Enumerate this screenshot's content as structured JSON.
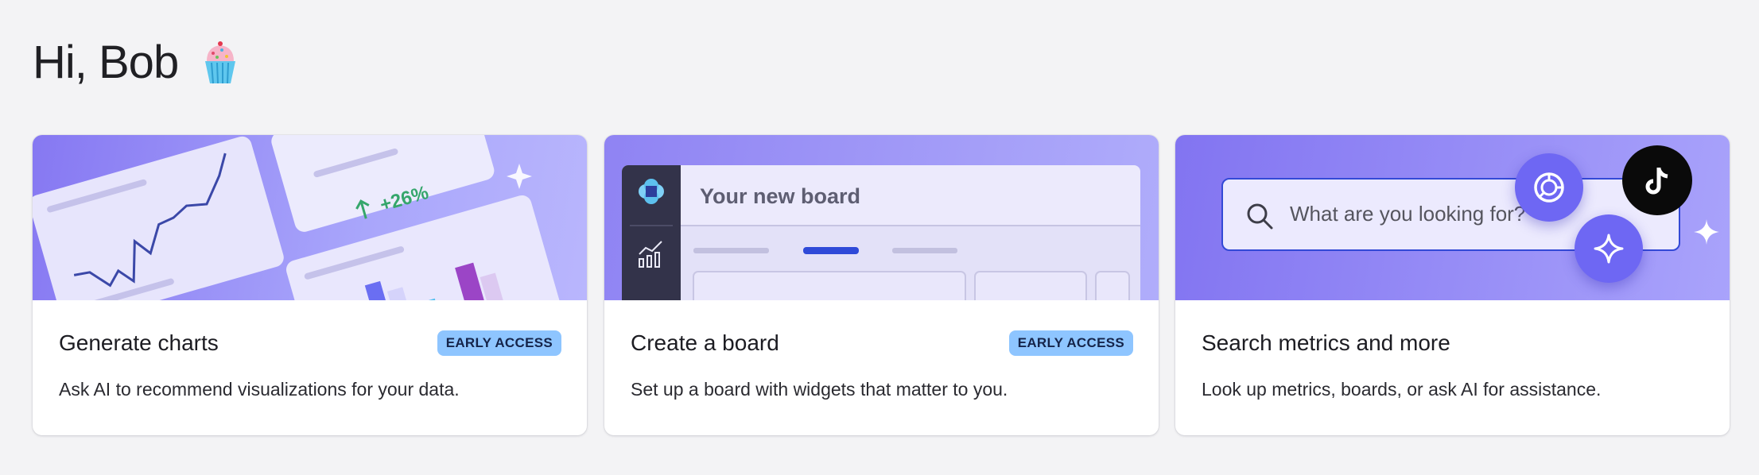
{
  "greeting": {
    "text": "Hi, Bob",
    "emoji": "cupcake-icon"
  },
  "cards": [
    {
      "title": "Generate charts",
      "badge": "EARLY ACCESS",
      "description": "Ask AI to recommend visualizations for your data.",
      "hero": {
        "growth_label": "+26%"
      }
    },
    {
      "title": "Create a board",
      "badge": "EARLY ACCESS",
      "description": "Set up a board with widgets that matter to you.",
      "hero": {
        "board_title": "Your new board"
      }
    },
    {
      "title": "Search metrics and more",
      "description": "Look up metrics, boards, or ask AI for assistance.",
      "hero": {
        "search_placeholder": "What are you looking for?"
      }
    }
  ],
  "colors": {
    "accent": "#8ec5ff",
    "hero": "#8678f2",
    "search_border": "#3349d6"
  }
}
